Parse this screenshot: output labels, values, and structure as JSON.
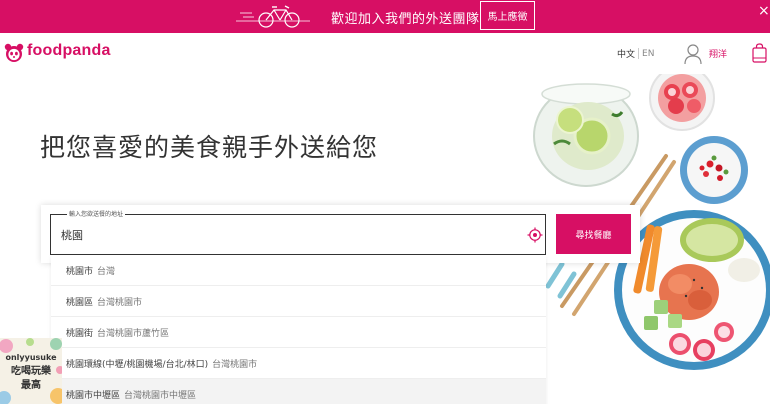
{
  "promo": {
    "text": "歡迎加入我們的外送團隊",
    "button": "馬上應徵",
    "close": "×"
  },
  "header": {
    "brand": "foodpanda",
    "lang_zh": "中文",
    "lang_en": "EN",
    "user_name": "翔洋"
  },
  "hero": {
    "title": "把您喜愛的美食親手外送給您"
  },
  "search": {
    "label": "輸入您欲送餐的地址",
    "value": "桃園",
    "button": "尋找餐廳"
  },
  "suggestions": [
    {
      "main": "桃園市",
      "sub": "台灣"
    },
    {
      "main": "桃園區",
      "sub": "台灣桃園市"
    },
    {
      "main": "桃園街",
      "sub": "台灣桃園市蘆竹區"
    },
    {
      "main": "桃園環線(中壢/桃園機場/台北/林口)",
      "sub": "台灣桃園市"
    },
    {
      "main": "桃園市中壢區",
      "sub": "台灣桃園市中壢區"
    }
  ],
  "watermark": {
    "line1": "onlyyusuke",
    "line2": "吃喝玩樂",
    "line3": "最高"
  },
  "colors": {
    "brand": "#d70f64"
  }
}
